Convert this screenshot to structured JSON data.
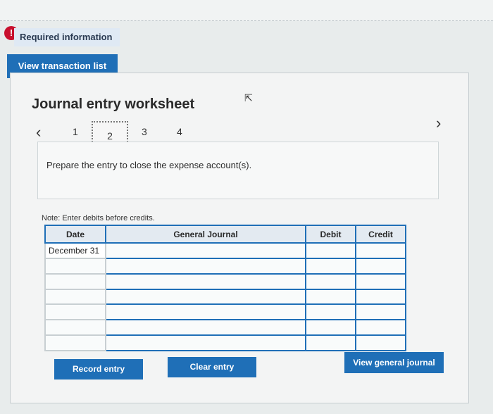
{
  "alert": {
    "icon": "!",
    "label": "Required information"
  },
  "view_transaction_label": "View transaction list",
  "worksheet": {
    "title": "Journal entry worksheet",
    "steps": [
      "1",
      "2",
      "3",
      "4"
    ],
    "active_step": "2",
    "instruction": "Prepare the entry to close the expense account(s).",
    "note": "Note: Enter debits before credits."
  },
  "table": {
    "headers": {
      "date": "Date",
      "journal": "General Journal",
      "debit": "Debit",
      "credit": "Credit"
    },
    "rows": [
      {
        "date": "December 31",
        "journal": "",
        "debit": "",
        "credit": ""
      },
      {
        "date": "",
        "journal": "",
        "debit": "",
        "credit": ""
      },
      {
        "date": "",
        "journal": "",
        "debit": "",
        "credit": ""
      },
      {
        "date": "",
        "journal": "",
        "debit": "",
        "credit": ""
      },
      {
        "date": "",
        "journal": "",
        "debit": "",
        "credit": ""
      },
      {
        "date": "",
        "journal": "",
        "debit": "",
        "credit": ""
      },
      {
        "date": "",
        "journal": "",
        "debit": "",
        "credit": ""
      }
    ]
  },
  "buttons": {
    "record": "Record entry",
    "clear": "Clear entry",
    "view_general_journal": "View general journal"
  },
  "colors": {
    "accent": "#1f6fb7",
    "alert": "#c8102e"
  }
}
